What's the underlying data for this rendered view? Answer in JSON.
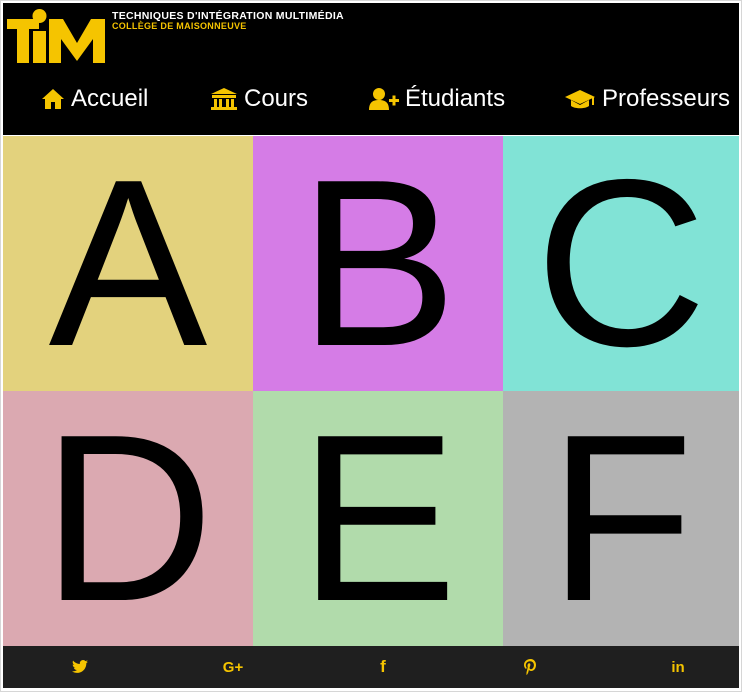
{
  "colors": {
    "accent": "#f5c400",
    "header_bg": "#000000",
    "footer_bg": "#1f1f1f"
  },
  "header": {
    "logo_text": "TIM",
    "school_line1": "TECHNIQUES D'INTÉGRATION MULTIMÉDIA",
    "school_line2": "COLLÈGE DE MAISONNEUVE"
  },
  "nav": {
    "items": [
      {
        "label": "Accueil",
        "icon": "home-icon"
      },
      {
        "label": "Cours",
        "icon": "institution-icon"
      },
      {
        "label": "Étudiants",
        "icon": "user-plus-icon"
      },
      {
        "label": "Professeurs",
        "icon": "graduation-cap-icon"
      }
    ]
  },
  "tiles": [
    {
      "letter": "A",
      "color": "#e3d27d"
    },
    {
      "letter": "B",
      "color": "#d57ce6"
    },
    {
      "letter": "C",
      "color": "#81e3d6"
    },
    {
      "letter": "D",
      "color": "#dba9b1"
    },
    {
      "letter": "E",
      "color": "#b1dbab"
    },
    {
      "letter": "F",
      "color": "#b3b3b3"
    }
  ],
  "footer": {
    "social": [
      {
        "icon": "twitter-icon",
        "glyph": "t"
      },
      {
        "icon": "google-plus-icon",
        "glyph": "G+"
      },
      {
        "icon": "facebook-icon",
        "glyph": "f"
      },
      {
        "icon": "pinterest-icon",
        "glyph": "p"
      },
      {
        "icon": "linkedin-icon",
        "glyph": "in"
      }
    ]
  }
}
